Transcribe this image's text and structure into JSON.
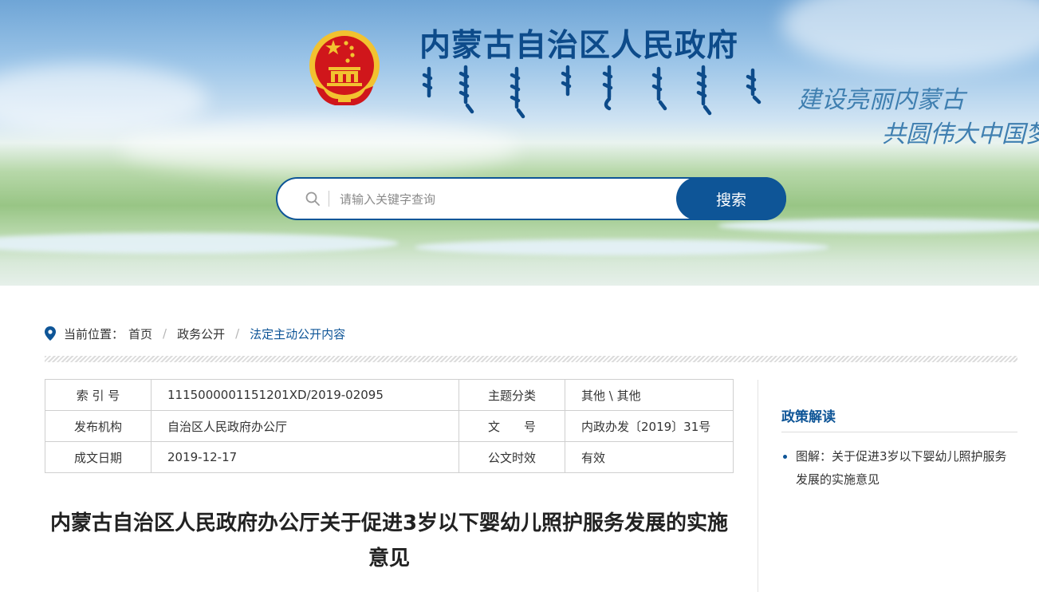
{
  "header": {
    "site_title": "内蒙古自治区人民政府",
    "slogan_line1": "建设亮丽内蒙古",
    "slogan_line2": "共圆伟大中国梦"
  },
  "search": {
    "placeholder": "请输入关键字查询",
    "button_label": "搜索"
  },
  "breadcrumb": {
    "label": "当前位置：",
    "items": [
      "首页",
      "政务公开",
      "法定主动公开内容"
    ]
  },
  "meta_table": {
    "rows": [
      {
        "k1": "索 引 号",
        "v1": "1115000001151201XD/2019-02095",
        "k2": "主题分类",
        "v2": "其他 \\ 其他"
      },
      {
        "k1": "发布机构",
        "v1": "自治区人民政府办公厅",
        "k2": "文　　号",
        "v2": "内政办发〔2019〕31号"
      },
      {
        "k1": "成文日期",
        "v1": "2019-12-17",
        "k2": "公文时效",
        "v2": "有效"
      }
    ]
  },
  "document": {
    "title": "内蒙古自治区人民政府办公厅关于促进3岁以下婴幼儿照护服务发展的实施意见"
  },
  "sidebar": {
    "title": "政策解读",
    "items": [
      "图解：关于促进3岁以下婴幼儿照护服务发展的实施意见"
    ]
  },
  "colors": {
    "brand_blue": "#0e5597",
    "title_blue": "#0d4b8a",
    "emblem_red": "#d0161b",
    "emblem_gold": "#f2c230"
  }
}
